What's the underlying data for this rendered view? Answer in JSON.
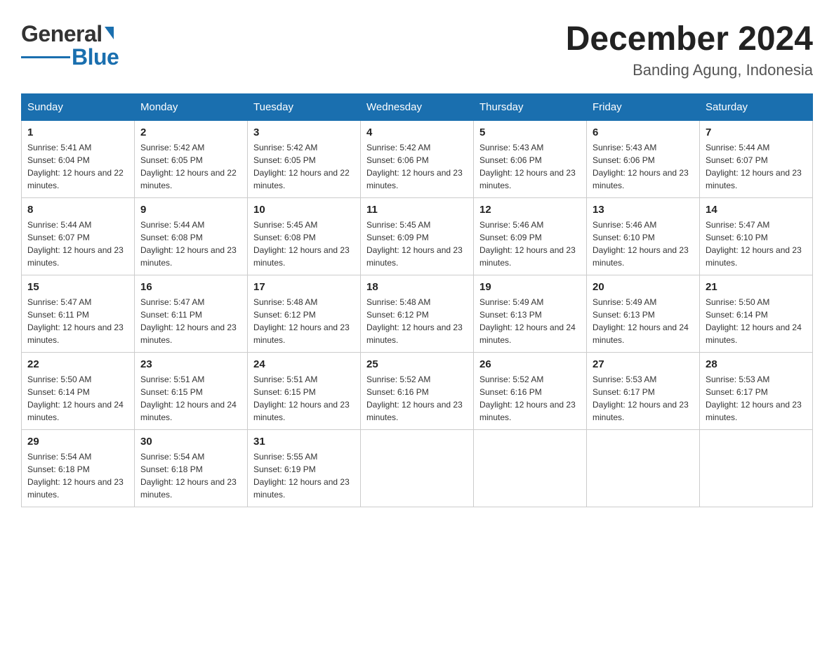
{
  "header": {
    "logo_general": "General",
    "logo_blue": "Blue",
    "month_year": "December 2024",
    "location": "Banding Agung, Indonesia"
  },
  "days_of_week": [
    "Sunday",
    "Monday",
    "Tuesday",
    "Wednesday",
    "Thursday",
    "Friday",
    "Saturday"
  ],
  "weeks": [
    [
      {
        "day": "1",
        "sunrise": "5:41 AM",
        "sunset": "6:04 PM",
        "daylight": "12 hours and 22 minutes."
      },
      {
        "day": "2",
        "sunrise": "5:42 AM",
        "sunset": "6:05 PM",
        "daylight": "12 hours and 22 minutes."
      },
      {
        "day": "3",
        "sunrise": "5:42 AM",
        "sunset": "6:05 PM",
        "daylight": "12 hours and 22 minutes."
      },
      {
        "day": "4",
        "sunrise": "5:42 AM",
        "sunset": "6:06 PM",
        "daylight": "12 hours and 23 minutes."
      },
      {
        "day": "5",
        "sunrise": "5:43 AM",
        "sunset": "6:06 PM",
        "daylight": "12 hours and 23 minutes."
      },
      {
        "day": "6",
        "sunrise": "5:43 AM",
        "sunset": "6:06 PM",
        "daylight": "12 hours and 23 minutes."
      },
      {
        "day": "7",
        "sunrise": "5:44 AM",
        "sunset": "6:07 PM",
        "daylight": "12 hours and 23 minutes."
      }
    ],
    [
      {
        "day": "8",
        "sunrise": "5:44 AM",
        "sunset": "6:07 PM",
        "daylight": "12 hours and 23 minutes."
      },
      {
        "day": "9",
        "sunrise": "5:44 AM",
        "sunset": "6:08 PM",
        "daylight": "12 hours and 23 minutes."
      },
      {
        "day": "10",
        "sunrise": "5:45 AM",
        "sunset": "6:08 PM",
        "daylight": "12 hours and 23 minutes."
      },
      {
        "day": "11",
        "sunrise": "5:45 AM",
        "sunset": "6:09 PM",
        "daylight": "12 hours and 23 minutes."
      },
      {
        "day": "12",
        "sunrise": "5:46 AM",
        "sunset": "6:09 PM",
        "daylight": "12 hours and 23 minutes."
      },
      {
        "day": "13",
        "sunrise": "5:46 AM",
        "sunset": "6:10 PM",
        "daylight": "12 hours and 23 minutes."
      },
      {
        "day": "14",
        "sunrise": "5:47 AM",
        "sunset": "6:10 PM",
        "daylight": "12 hours and 23 minutes."
      }
    ],
    [
      {
        "day": "15",
        "sunrise": "5:47 AM",
        "sunset": "6:11 PM",
        "daylight": "12 hours and 23 minutes."
      },
      {
        "day": "16",
        "sunrise": "5:47 AM",
        "sunset": "6:11 PM",
        "daylight": "12 hours and 23 minutes."
      },
      {
        "day": "17",
        "sunrise": "5:48 AM",
        "sunset": "6:12 PM",
        "daylight": "12 hours and 23 minutes."
      },
      {
        "day": "18",
        "sunrise": "5:48 AM",
        "sunset": "6:12 PM",
        "daylight": "12 hours and 23 minutes."
      },
      {
        "day": "19",
        "sunrise": "5:49 AM",
        "sunset": "6:13 PM",
        "daylight": "12 hours and 24 minutes."
      },
      {
        "day": "20",
        "sunrise": "5:49 AM",
        "sunset": "6:13 PM",
        "daylight": "12 hours and 24 minutes."
      },
      {
        "day": "21",
        "sunrise": "5:50 AM",
        "sunset": "6:14 PM",
        "daylight": "12 hours and 24 minutes."
      }
    ],
    [
      {
        "day": "22",
        "sunrise": "5:50 AM",
        "sunset": "6:14 PM",
        "daylight": "12 hours and 24 minutes."
      },
      {
        "day": "23",
        "sunrise": "5:51 AM",
        "sunset": "6:15 PM",
        "daylight": "12 hours and 24 minutes."
      },
      {
        "day": "24",
        "sunrise": "5:51 AM",
        "sunset": "6:15 PM",
        "daylight": "12 hours and 23 minutes."
      },
      {
        "day": "25",
        "sunrise": "5:52 AM",
        "sunset": "6:16 PM",
        "daylight": "12 hours and 23 minutes."
      },
      {
        "day": "26",
        "sunrise": "5:52 AM",
        "sunset": "6:16 PM",
        "daylight": "12 hours and 23 minutes."
      },
      {
        "day": "27",
        "sunrise": "5:53 AM",
        "sunset": "6:17 PM",
        "daylight": "12 hours and 23 minutes."
      },
      {
        "day": "28",
        "sunrise": "5:53 AM",
        "sunset": "6:17 PM",
        "daylight": "12 hours and 23 minutes."
      }
    ],
    [
      {
        "day": "29",
        "sunrise": "5:54 AM",
        "sunset": "6:18 PM",
        "daylight": "12 hours and 23 minutes."
      },
      {
        "day": "30",
        "sunrise": "5:54 AM",
        "sunset": "6:18 PM",
        "daylight": "12 hours and 23 minutes."
      },
      {
        "day": "31",
        "sunrise": "5:55 AM",
        "sunset": "6:19 PM",
        "daylight": "12 hours and 23 minutes."
      },
      null,
      null,
      null,
      null
    ]
  ],
  "labels": {
    "sunrise": "Sunrise:",
    "sunset": "Sunset:",
    "daylight": "Daylight:"
  }
}
